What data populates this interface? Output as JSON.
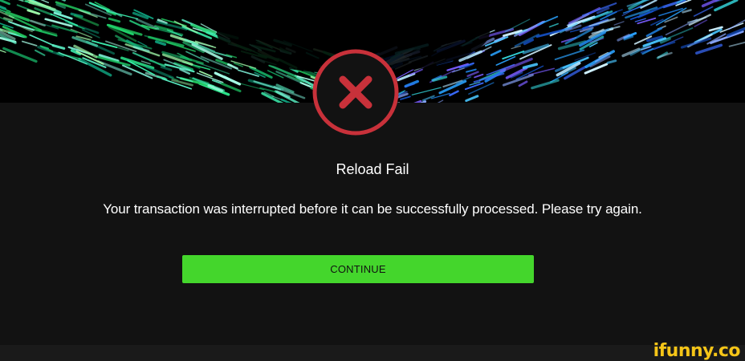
{
  "dialog": {
    "status_icon": "error-x-circle-icon",
    "title": "Reload Fail",
    "message": "Your transaction was interrupted before it can be successfully processed. Please try again.",
    "continue_label": "CONTINUE"
  },
  "watermark": {
    "text": "ifunny.co"
  },
  "colors": {
    "background": "#121212",
    "accent_green": "#44d62c",
    "error_red": "#c8313a",
    "text": "#ffffff"
  }
}
